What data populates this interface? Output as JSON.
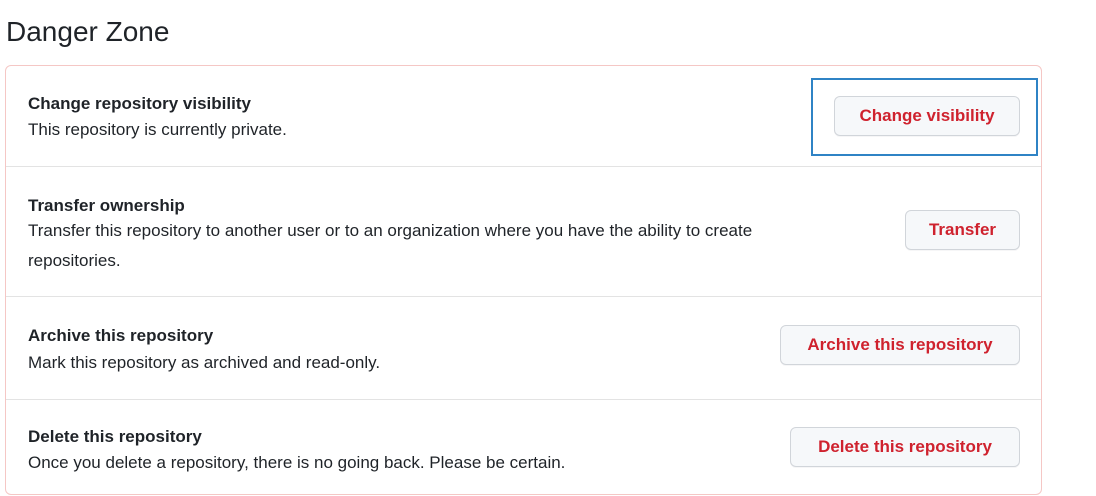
{
  "page": {
    "title": "Danger Zone"
  },
  "rows": [
    {
      "title": "Change repository visibility",
      "description": "This repository is currently private.",
      "button": "Change visibility"
    },
    {
      "title": "Transfer ownership",
      "description_line1": "Transfer this repository to another user or to an organization where you have the ability to create",
      "description_line2": "repositories.",
      "button": "Transfer"
    },
    {
      "title": "Archive this repository",
      "description": "Mark this repository as archived and read-only.",
      "button": "Archive this repository"
    },
    {
      "title": "Delete this repository",
      "description": "Once you delete a repository, there is no going back. Please be certain.",
      "button": "Delete this repository"
    }
  ],
  "colors": {
    "danger_text": "#cf222e",
    "border": "#f5c7c5",
    "focus": "#2f83c5"
  }
}
